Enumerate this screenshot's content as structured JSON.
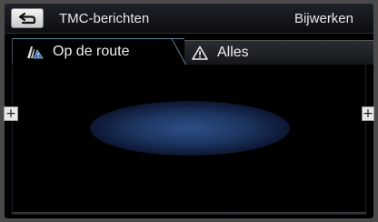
{
  "header": {
    "title": "TMC-berichten",
    "update_label": "Bijwerken",
    "back_icon": "back-arrow-icon"
  },
  "tabs": [
    {
      "label": "Op de route",
      "icon": "route-traffic-icon",
      "active": true
    },
    {
      "label": "Alles",
      "icon": "warning-triangle-icon",
      "active": false
    }
  ],
  "side_controls": {
    "left_symbol": "+",
    "right_symbol": "+"
  },
  "colors": {
    "accent": "#5f7f96",
    "background": "#000000",
    "glow": "#2d4f86"
  }
}
